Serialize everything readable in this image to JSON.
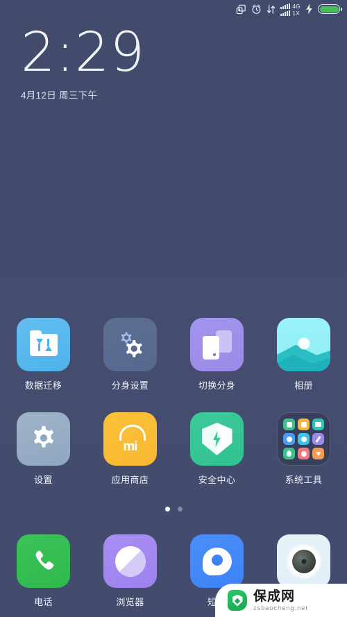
{
  "status_bar": {
    "icons": [
      "multi-window-icon",
      "alarm-clock-icon",
      "data-transfer-icon"
    ],
    "signal_primary_label": "4G",
    "signal_secondary_label": "1X",
    "charging": true,
    "battery_color": "#41c352"
  },
  "clock": {
    "time": "2:29",
    "date": "4月12日 周三下午"
  },
  "home": {
    "rows": [
      [
        {
          "label": "数据迁移",
          "icon": "data-migration-icon",
          "color": "#4fb2ec"
        },
        {
          "label": "分身设置",
          "icon": "clone-settings-icon",
          "color": "#56688e"
        },
        {
          "label": "切换分身",
          "icon": "switch-clone-icon",
          "color": "#9b8ae8"
        },
        {
          "label": "相册",
          "icon": "gallery-icon",
          "color": "#8ceef5"
        }
      ],
      [
        {
          "label": "设置",
          "icon": "settings-gear-icon",
          "color": "#8fa7c0"
        },
        {
          "label": "应用商店",
          "icon": "app-store-icon",
          "color": "#f7b832"
        },
        {
          "label": "安全中心",
          "icon": "security-shield-icon",
          "color": "#31c28f"
        },
        {
          "label": "系统工具",
          "icon": "system-tools-folder-icon",
          "color": "#2e354d"
        }
      ]
    ],
    "folder_apps": [
      {
        "name": "contacts-mini-icon",
        "color": "#3fc08a"
      },
      {
        "name": "file-manager-mini-icon",
        "color": "#f5b63a"
      },
      {
        "name": "mail-mini-icon",
        "color": "#2dc4b6"
      },
      {
        "name": "browser-mini-icon",
        "color": "#4a9df0"
      },
      {
        "name": "weather-mini-icon",
        "color": "#3ec3e8"
      },
      {
        "name": "notes-mini-icon",
        "color": "#9b8ae8"
      },
      {
        "name": "recorder-mini-icon",
        "color": "#3fc08a"
      },
      {
        "name": "clock-mini-icon",
        "color": "#f4767e"
      },
      {
        "name": "downloads-mini-icon",
        "color": "#f79a55"
      }
    ],
    "page_indicator": {
      "count": 2,
      "active_index": 0
    }
  },
  "dock": [
    {
      "label": "电话",
      "icon": "phone-icon",
      "color": "#2eb94d"
    },
    {
      "label": "浏览器",
      "icon": "browser-icon",
      "color": "#9d82ef"
    },
    {
      "label": "短信",
      "icon": "sms-icon",
      "color": "#3d83f6"
    },
    {
      "label": "",
      "icon": "camera-icon",
      "color": "#dfeef6"
    }
  ],
  "watermark": {
    "title": "保成网",
    "subtitle": "zsbaocheng.net"
  }
}
